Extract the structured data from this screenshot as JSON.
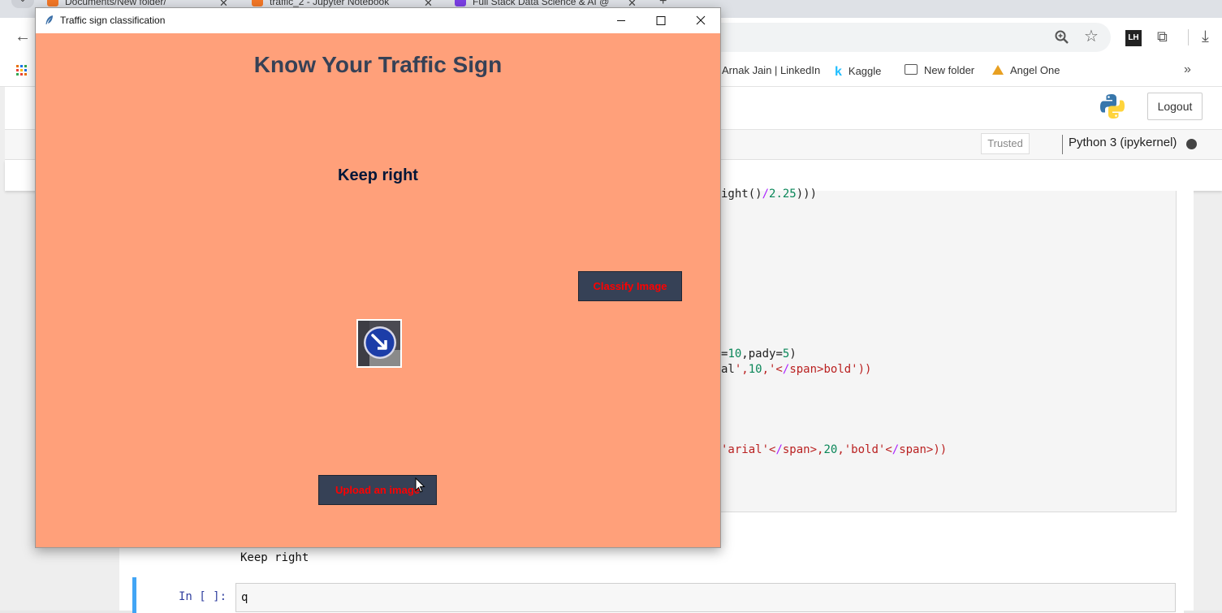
{
  "browser": {
    "tabs": [
      {
        "label": "Documents/New folder/",
        "icon_color": "#f37726"
      },
      {
        "label": "traffic_2 - Jupyter Notebook",
        "icon_color": "#f37726"
      },
      {
        "label": "Full Stack Data Science & AI @",
        "icon_color": "#7b3fe4"
      }
    ],
    "close_glyph": "✕",
    "new_tab_glyph": "+",
    "bookmarks": [
      {
        "label": "Arnak Jain | LinkedIn"
      },
      {
        "label": "Kaggle",
        "icon": "k"
      },
      {
        "label": "New folder"
      },
      {
        "label": "Angel One"
      }
    ],
    "extension_label": "LH",
    "icons": [
      "back-arrow-icon",
      "zoom-icon",
      "star-icon",
      "puzzle-icon",
      "download-icon",
      "apps-grid-icon",
      "chevron-more-icon"
    ]
  },
  "jupyter": {
    "logout_label": "Logout",
    "trusted_label": "Trusted",
    "kernel_label": "Python 3 (ipykernel)",
    "code_lines": [
      {
        "text": "ight()/2.25)))"
      },
      {
        "text": "=10,pady=5)"
      },
      {
        "text": "al',10,'bold'))"
      },
      {
        "text": "'arial',20,'bold'))"
      }
    ],
    "output_text": "Keep right",
    "input_prompt": "In [ ]:",
    "input_value": "q"
  },
  "tk_app": {
    "window_title": "Traffic sign classification",
    "heading": "Know Your Traffic Sign",
    "result_label": "Keep right",
    "classify_button": "Classify Image",
    "upload_button": "Upload an image",
    "bg_color": "#ffa07a",
    "button_bg": "#364156",
    "button_fg": "#ff0000"
  }
}
